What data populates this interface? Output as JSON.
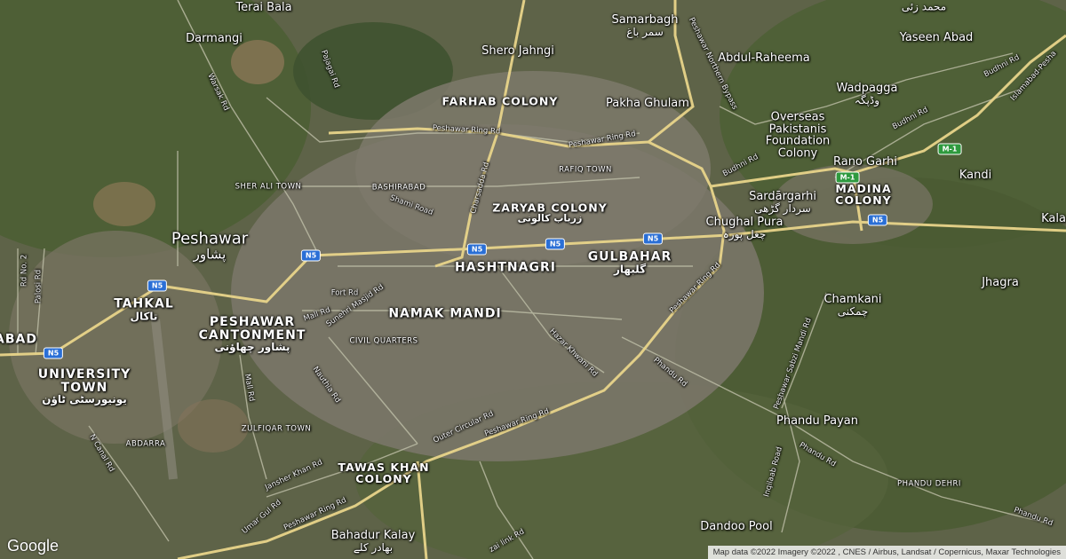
{
  "places": [
    {
      "id": "terai-bala",
      "name": "Terai Bala",
      "urdu": ""
    },
    {
      "id": "darmangi",
      "name": "Darmangi",
      "urdu": ""
    },
    {
      "id": "shero-jahngi",
      "name": "Shero Jahngi",
      "urdu": ""
    },
    {
      "id": "samarbagh",
      "name": "Samarbagh",
      "urdu": "سمر باغ"
    },
    {
      "id": "abdul-raheema",
      "name": "Abdul-Raheema",
      "urdu": ""
    },
    {
      "id": "yaseen-abad",
      "name": "Yaseen Abad",
      "urdu": ""
    },
    {
      "id": "pakha-ghulam",
      "name": "Pakha Ghulam",
      "urdu": ""
    },
    {
      "id": "wadpagga",
      "name": "Wadpagga",
      "urdu": "وڈپگہ"
    },
    {
      "id": "overseas",
      "name": "Overseas\nPakistanis\nFoundation\nColony",
      "urdu": ""
    },
    {
      "id": "rano-garhi",
      "name": "Rano Garhi",
      "urdu": ""
    },
    {
      "id": "kandi",
      "name": "Kandi",
      "urdu": ""
    },
    {
      "id": "sardargarhi",
      "name": "Sardārgarhi",
      "urdu": "سردار گڑھی"
    },
    {
      "id": "chughal-pura",
      "name": "Chughal Pura",
      "urdu": "چغل پورہ"
    },
    {
      "id": "kala",
      "name": "Kala",
      "urdu": ""
    },
    {
      "id": "peshawar",
      "name": "Peshawar",
      "urdu": "پشاور"
    },
    {
      "id": "jhagra",
      "name": "Jhagra",
      "urdu": ""
    },
    {
      "id": "chamkani",
      "name": "Chamkani",
      "urdu": "چمکنی"
    },
    {
      "id": "phandu-payan",
      "name": "Phandu Payan",
      "urdu": ""
    },
    {
      "id": "bahadur-kalay",
      "name": "Bahadur Kalay",
      "urdu": "بهادر کلے"
    },
    {
      "id": "dandoo-pool",
      "name": "Dandoo Pool",
      "urdu": ""
    },
    {
      "id": "top-right-urdu",
      "name": "",
      "urdu": "محمد زئی"
    }
  ],
  "districts": [
    {
      "id": "farhab-colony",
      "name": "FARHAB COLONY",
      "urdu": ""
    },
    {
      "id": "zaryab-colony",
      "name": "ZARYAB COLONY",
      "urdu": "زریاب کالونی"
    },
    {
      "id": "hashtnagri",
      "name": "HASHTNAGRI",
      "urdu": ""
    },
    {
      "id": "gulbahar",
      "name": "GULBAHAR",
      "urdu": "گلبهار"
    },
    {
      "id": "namak-mandi",
      "name": "NAMAK MANDI",
      "urdu": ""
    },
    {
      "id": "tahkal",
      "name": "TAHKAL",
      "urdu": "تاکال"
    },
    {
      "id": "peshawar-cantonment",
      "name": "PESHAWAR\nCANTONMENT",
      "urdu": "پشاور چهاؤنی"
    },
    {
      "id": "university-town",
      "name": "UNIVERSITY\nTOWN",
      "urdu": "یونیورسٹی ٹاؤن"
    },
    {
      "id": "madina-colony",
      "name": "MADINA\nCOLONY",
      "urdu": ""
    },
    {
      "id": "tawas-khan",
      "name": "TAWAS KHAN\nCOLONY",
      "urdu": ""
    },
    {
      "id": "abad-left",
      "name": "ABAD",
      "urdu": ""
    }
  ],
  "small_labels": [
    {
      "id": "rafiq-town",
      "name": "RAFIQ TOWN"
    },
    {
      "id": "bashirabad",
      "name": "BASHIRABAD"
    },
    {
      "id": "sher-ali-town",
      "name": "SHER ALI TOWN"
    },
    {
      "id": "civil-quarters",
      "name": "CIVIL QUARTERS"
    },
    {
      "id": "zulfiqar-town",
      "name": "ZULFIQAR TOWN"
    },
    {
      "id": "abdarra",
      "name": "ABDARRA"
    },
    {
      "id": "phandu-dehri",
      "name": "PHANDU DEHRI"
    }
  ],
  "roads": [
    {
      "id": "peshawar-ring-rd-1",
      "name": "Peshawar Ring Rd"
    },
    {
      "id": "peshawar-ring-rd-2",
      "name": "Peshawar Ring Rd"
    },
    {
      "id": "peshawar-ring-rd-3",
      "name": "Peshawar Ring Rd"
    },
    {
      "id": "peshawar-ring-rd-4",
      "name": "Peshawar Ring Rd"
    },
    {
      "id": "peshawar-ring-rd-5",
      "name": "Peshawar Ring Rd"
    },
    {
      "id": "charsadda-rd",
      "name": "Charsadda Rd"
    },
    {
      "id": "warsak-rd",
      "name": "Warsak Rd"
    },
    {
      "id": "pajagai-rd",
      "name": "Pajagai Rd"
    },
    {
      "id": "shami-road",
      "name": "Shami Road"
    },
    {
      "id": "fort-rd",
      "name": "Fort Rd"
    },
    {
      "id": "mall-rd-1",
      "name": "Mall Rd"
    },
    {
      "id": "mall-rd-2",
      "name": "Mall Rd"
    },
    {
      "id": "sunehri-masjid-rd",
      "name": "Sunehri Masjid Rd"
    },
    {
      "id": "nauthia-rd",
      "name": "Nauthia Rd"
    },
    {
      "id": "hazar-khwani-rd",
      "name": "Hazar Khwani Rd"
    },
    {
      "id": "outer-circular-rd",
      "name": "Outer Circular Rd"
    },
    {
      "id": "phandu-rd",
      "name": "Phandu Rd"
    },
    {
      "id": "peshawar-sabzi-mandi-rd",
      "name": "Peshawar Sabzi Mandi Rd"
    },
    {
      "id": "inqilaab-road",
      "name": "Inqilaab Road"
    },
    {
      "id": "phandu-rd-2",
      "name": "Phandu Rd"
    },
    {
      "id": "budhni-rd-1",
      "name": "Budhni Rd"
    },
    {
      "id": "budhni-rd-2",
      "name": "Budhni Rd"
    },
    {
      "id": "budhni-rd-3",
      "name": "Budhni Rd"
    },
    {
      "id": "islamabad-peshawar",
      "name": "Islamabad-Pesha"
    },
    {
      "id": "peshawar-northern-bypass",
      "name": "Peshawar Northern Bypass"
    },
    {
      "id": "jamshed-khan-rd",
      "name": "Jansher Khan Rd"
    },
    {
      "id": "umar-gul-rd",
      "name": "Umar Gul Rd"
    },
    {
      "id": "n-canal-rd",
      "name": "N Canal Rd"
    },
    {
      "id": "rd-no-2",
      "name": "Rd No. 2"
    },
    {
      "id": "palosi-rd",
      "name": "Palosi Rd"
    },
    {
      "id": "zai-link-rd",
      "name": "zai link Rd"
    },
    {
      "id": "phandu-rd-3",
      "name": "Phandu Rd"
    }
  ],
  "shields": [
    {
      "id": "n5-1",
      "name": "N5"
    },
    {
      "id": "n5-2",
      "name": "N5"
    },
    {
      "id": "n5-3",
      "name": "N5"
    },
    {
      "id": "n5-4",
      "name": "N5"
    },
    {
      "id": "n5-5",
      "name": "N5"
    },
    {
      "id": "n5-6",
      "name": "N5"
    },
    {
      "id": "n5-7",
      "name": "N5"
    },
    {
      "id": "m1-1",
      "name": "M-1"
    },
    {
      "id": "m1-2",
      "name": "M-1"
    }
  ],
  "attribution": "Map data ©2022 Imagery ©2022 , CNES / Airbus, Landsat / Copernicus, Maxar Technologies",
  "google_logo": "Google",
  "colors": {
    "n5_shield": "#2a6fd6",
    "m1_shield": "#2e9a3e",
    "highway": "#e8d48a",
    "road": "#bfbfa8"
  }
}
